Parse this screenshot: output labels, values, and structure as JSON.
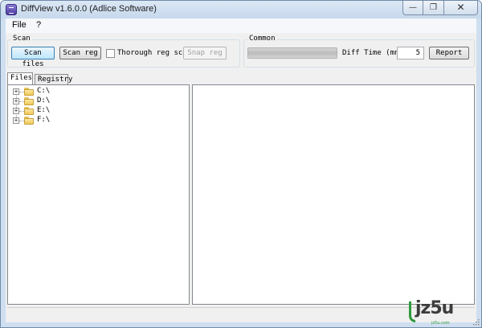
{
  "window": {
    "title": "DiffView v1.6.0.0 (Adlice Software)",
    "caption_buttons": [
      "minimize",
      "maximize",
      "close"
    ]
  },
  "menu": {
    "items": [
      "File",
      "?"
    ]
  },
  "scan": {
    "label": "Scan",
    "scan_files": "Scan files",
    "scan_reg": "Scan reg",
    "thorough_label": "Thorough reg scan",
    "thorough_checked": false,
    "snap_reg": "Snap reg"
  },
  "common": {
    "label": "Common",
    "progress_fraction": 1.0,
    "diff_time_label": "Diff Time (mn)",
    "diff_time_value": "5",
    "report": "Report"
  },
  "tabs": [
    {
      "label": "Files",
      "active": true
    },
    {
      "label": "Registry",
      "active": false
    }
  ],
  "tree": {
    "drives": [
      "C:\\",
      "D:\\",
      "E:\\",
      "F:\\"
    ]
  },
  "watermark": {
    "text": "jz5u",
    "sub": "jz5u.com"
  },
  "colors": {
    "titlebar": "#c6d8ec",
    "focus_button": "#bee6fd",
    "folder": "#efc756",
    "watermark_green": "#2f9a3c"
  }
}
